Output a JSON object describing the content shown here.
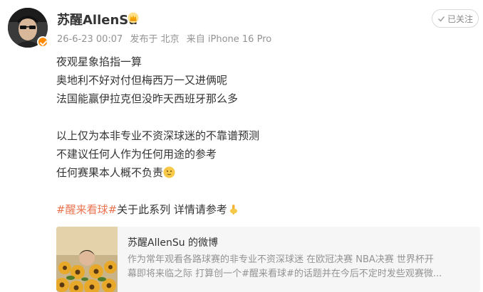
{
  "user": {
    "name": "苏醒AllenSu",
    "badge_color": "#ff8a00"
  },
  "meta": {
    "time": "26-6-23 00:07",
    "location": "发布于 北京",
    "source": "来自 iPhone 16 Pro"
  },
  "follow": {
    "label": "已关注"
  },
  "post": {
    "lines": [
      "夜观星象掐指一算",
      "奥地利不好对付但梅西万一又进俩呢",
      "法国能赢伊拉克但没昨天西班牙那么多",
      "以上仅为本非专业不资深球迷的不靠谱预测",
      "不建议任何人作为任何用途的参考",
      "任何赛果本人概不负责"
    ],
    "hashtag": "#醒来看球#",
    "tail": "关于此系列 详情请参考",
    "hashtag_color": "#eb7350"
  },
  "card": {
    "title": "苏醒AllenSu 的微博",
    "desc_line1": "作为常年观看各路球赛的非专业不资深球迷 在欧冠决赛 NBA决赛 世界杯开",
    "desc_line2": "幕即将来临之际 打算创一个#醒来看球#的话题并在今后不定时发些观赛微..."
  }
}
